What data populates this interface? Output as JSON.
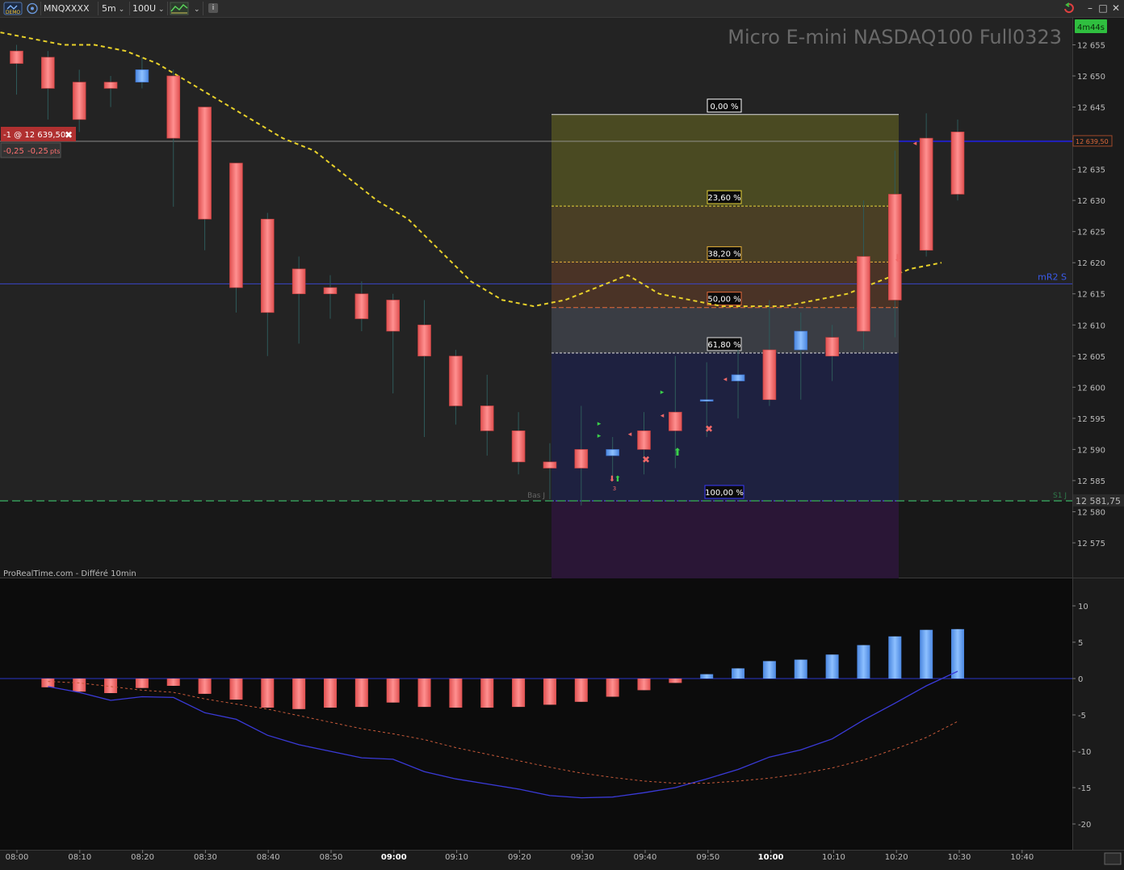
{
  "toolbar": {
    "demo_badge": "DEMO",
    "symbol": "MNQXXXX",
    "timeframe": "5m",
    "units": "100U",
    "info_label": "i"
  },
  "chart_title": "Micro E-mini NASDAQ100 Full0323",
  "timer": "4m44s",
  "watermark": "ProRealTime.com - Différé 10min",
  "position": {
    "label": "-1 @ 12 639,50",
    "pnl1": "-0,25",
    "pnl2": "-0,25",
    "pnl_unit": "pts",
    "price_axis_label": "12 639,50"
  },
  "levels": {
    "mR2_label": "mR2 S",
    "mR2_price": 12616.6,
    "S1_label": "S1 J",
    "S1_price": 12581.75,
    "S1_axis_label": "12 581,75",
    "bas_label": "Bas J"
  },
  "fibonacci": [
    {
      "label": "0,00 %",
      "price": 12643.8,
      "fill": "#4a4a22",
      "line": "#dddddd",
      "box_border": "#ffffff"
    },
    {
      "label": "23,60 %",
      "price": 12629.1,
      "fill": "#4a3f25",
      "line": "#e5d23a",
      "box_border": "#e5d23a"
    },
    {
      "label": "38,20 %",
      "price": 12620.1,
      "fill": "#4a3326",
      "line": "#e5b03a",
      "box_border": "#e5b03a"
    },
    {
      "label": "50,00 %",
      "price": 12612.8,
      "fill": "#3a3d44",
      "line": "#e56a3a",
      "box_border": "#e56a3a"
    },
    {
      "label": "61,80 %",
      "price": 12605.5,
      "fill": "#1e2140",
      "line": "#e0e0e0",
      "box_border": "#e0e0e0"
    },
    {
      "label": "100,00 %",
      "price": 12581.75,
      "fill": "#2a1636",
      "line": "#6060ff",
      "box_border": "#3a3aff"
    }
  ],
  "price_axis": {
    "ticks": [
      "12 655",
      "12 650",
      "12 645",
      "12 640",
      "12 635",
      "12 630",
      "12 625",
      "12 620",
      "12 615",
      "12 610",
      "12 605",
      "12 600",
      "12 595",
      "12 590",
      "12 585",
      "12 580",
      "12 575"
    ],
    "tick_values": [
      12655,
      12650,
      12645,
      12640,
      12635,
      12630,
      12625,
      12620,
      12615,
      12610,
      12605,
      12600,
      12595,
      12590,
      12585,
      12580,
      12575
    ]
  },
  "time_axis": {
    "labels": [
      "08:00",
      "08:10",
      "08:20",
      "08:30",
      "08:40",
      "08:50",
      "09:00",
      "09:10",
      "09:20",
      "09:30",
      "09:40",
      "09:50",
      "10:00",
      "10:10",
      "10:20",
      "10:30",
      "10:40"
    ],
    "bold": [
      "09:00",
      "10:00"
    ]
  },
  "osc_axis": {
    "ticks": [
      "10",
      "5",
      "0",
      "-5",
      "-10",
      "-15",
      "-20"
    ],
    "tick_values": [
      10,
      5,
      0,
      -5,
      -10,
      -15,
      -20
    ]
  },
  "colors": {
    "bull": "#6aa6f5",
    "bear": "#f06868",
    "ma": "#e8d12a",
    "osc_line": "#3a3ad8",
    "osc_signal": "#c85a3a",
    "pos_line": "#2020c0"
  },
  "chart_data": [
    {
      "type": "candlestick",
      "title": "Micro E-mini NASDAQ100 Full0323",
      "x": [
        "07:55",
        "08:00",
        "08:05",
        "08:10",
        "08:15",
        "08:20",
        "08:25",
        "08:30",
        "08:35",
        "08:40",
        "08:45",
        "08:50",
        "08:55",
        "09:00",
        "09:05",
        "09:10",
        "09:15",
        "09:20",
        "09:25",
        "09:30",
        "09:35",
        "09:40",
        "09:45",
        "09:50",
        "09:55",
        "10:00",
        "10:05",
        "10:10",
        "10:15",
        "10:20",
        "10:25"
      ],
      "open": [
        12654,
        12653,
        12649,
        12649,
        12649,
        12650,
        12645,
        12636,
        12627,
        12619,
        12616,
        12615,
        12614,
        12610,
        12605,
        12597,
        12593,
        12588,
        12590,
        12589,
        12593,
        12596,
        12598,
        12601,
        12606,
        12606,
        12608,
        12621,
        12631,
        12640,
        12641
      ],
      "high": [
        12655,
        12654,
        12651,
        12650,
        12653,
        12651,
        12645,
        12636,
        12628,
        12621,
        12618,
        12617,
        12615,
        12614,
        12606,
        12602,
        12596,
        12591,
        12597,
        12592,
        12596,
        12605,
        12604,
        12606,
        12614,
        12612,
        12610,
        12630,
        12638,
        12644,
        12643
      ],
      "low": [
        12647,
        12643,
        12641,
        12645,
        12648,
        12629,
        12622,
        12612,
        12605,
        12607,
        12611,
        12609,
        12599,
        12592,
        12594,
        12589,
        12586,
        12582,
        12581,
        12585,
        12586,
        12587,
        12592,
        12595,
        12597,
        12598,
        12601,
        12606,
        12608,
        12621,
        12630
      ],
      "close": [
        12652,
        12648,
        12643,
        12648,
        12651,
        12640,
        12627,
        12616,
        12612,
        12615,
        12615,
        12611,
        12609,
        12605,
        12597,
        12593,
        12588,
        12587,
        12587,
        12590,
        12590,
        12593,
        12598,
        12602,
        12598,
        12609,
        12605,
        12609,
        12614,
        12622,
        12631
      ],
      "ma_curve": [
        12657,
        12656,
        12655,
        12655,
        12654,
        12652,
        12649,
        12646,
        12643,
        12640,
        12638,
        12634,
        12630,
        12627,
        12622,
        12617,
        12614,
        12613,
        12614,
        12616,
        12618,
        12615,
        12614,
        12613,
        12613,
        12613,
        12614,
        12615,
        12617,
        12619,
        12620
      ]
    },
    {
      "type": "histogram",
      "ylim": [
        -20,
        10
      ],
      "x": [
        "08:00",
        "08:05",
        "08:10",
        "08:15",
        "08:20",
        "08:25",
        "08:30",
        "08:35",
        "08:40",
        "08:45",
        "08:50",
        "08:55",
        "09:00",
        "09:05",
        "09:10",
        "09:15",
        "09:20",
        "09:25",
        "09:30",
        "09:35",
        "09:40",
        "09:45",
        "09:50",
        "09:55",
        "10:00",
        "10:05",
        "10:10",
        "10:15",
        "10:20",
        "10:25"
      ],
      "values": [
        -1.2,
        -1.8,
        -2.0,
        -1.3,
        -1.0,
        -2.1,
        -2.9,
        -4.0,
        -4.2,
        -4.0,
        -3.9,
        -3.3,
        -3.9,
        -4.0,
        -4.0,
        -3.9,
        -3.6,
        -3.2,
        -2.5,
        -1.6,
        -0.6,
        0.6,
        1.4,
        2.4,
        2.6,
        3.3,
        4.6,
        5.8,
        6.7,
        6.8
      ],
      "line": [
        -1.1,
        -1.9,
        -3.0,
        -2.5,
        -2.6,
        -4.7,
        -5.6,
        -7.8,
        -9.1,
        -10.0,
        -10.9,
        -11.1,
        -12.8,
        -13.8,
        -14.5,
        -15.2,
        -16.1,
        -16.4,
        -16.3,
        -15.7,
        -15.0,
        -13.8,
        -12.5,
        -10.8,
        -9.8,
        -8.3,
        -5.7,
        -3.4,
        -1.0,
        1.0
      ],
      "signal": [
        -0.4,
        -0.6,
        -1.1,
        -1.6,
        -1.9,
        -2.8,
        -3.5,
        -4.2,
        -5.1,
        -6.0,
        -6.9,
        -7.6,
        -8.4,
        -9.5,
        -10.4,
        -11.3,
        -12.2,
        -13.0,
        -13.6,
        -14.1,
        -14.4,
        -14.4,
        -14.1,
        -13.7,
        -13.1,
        -12.3,
        -11.2,
        -9.7,
        -8.1,
        -5.9
      ]
    }
  ]
}
